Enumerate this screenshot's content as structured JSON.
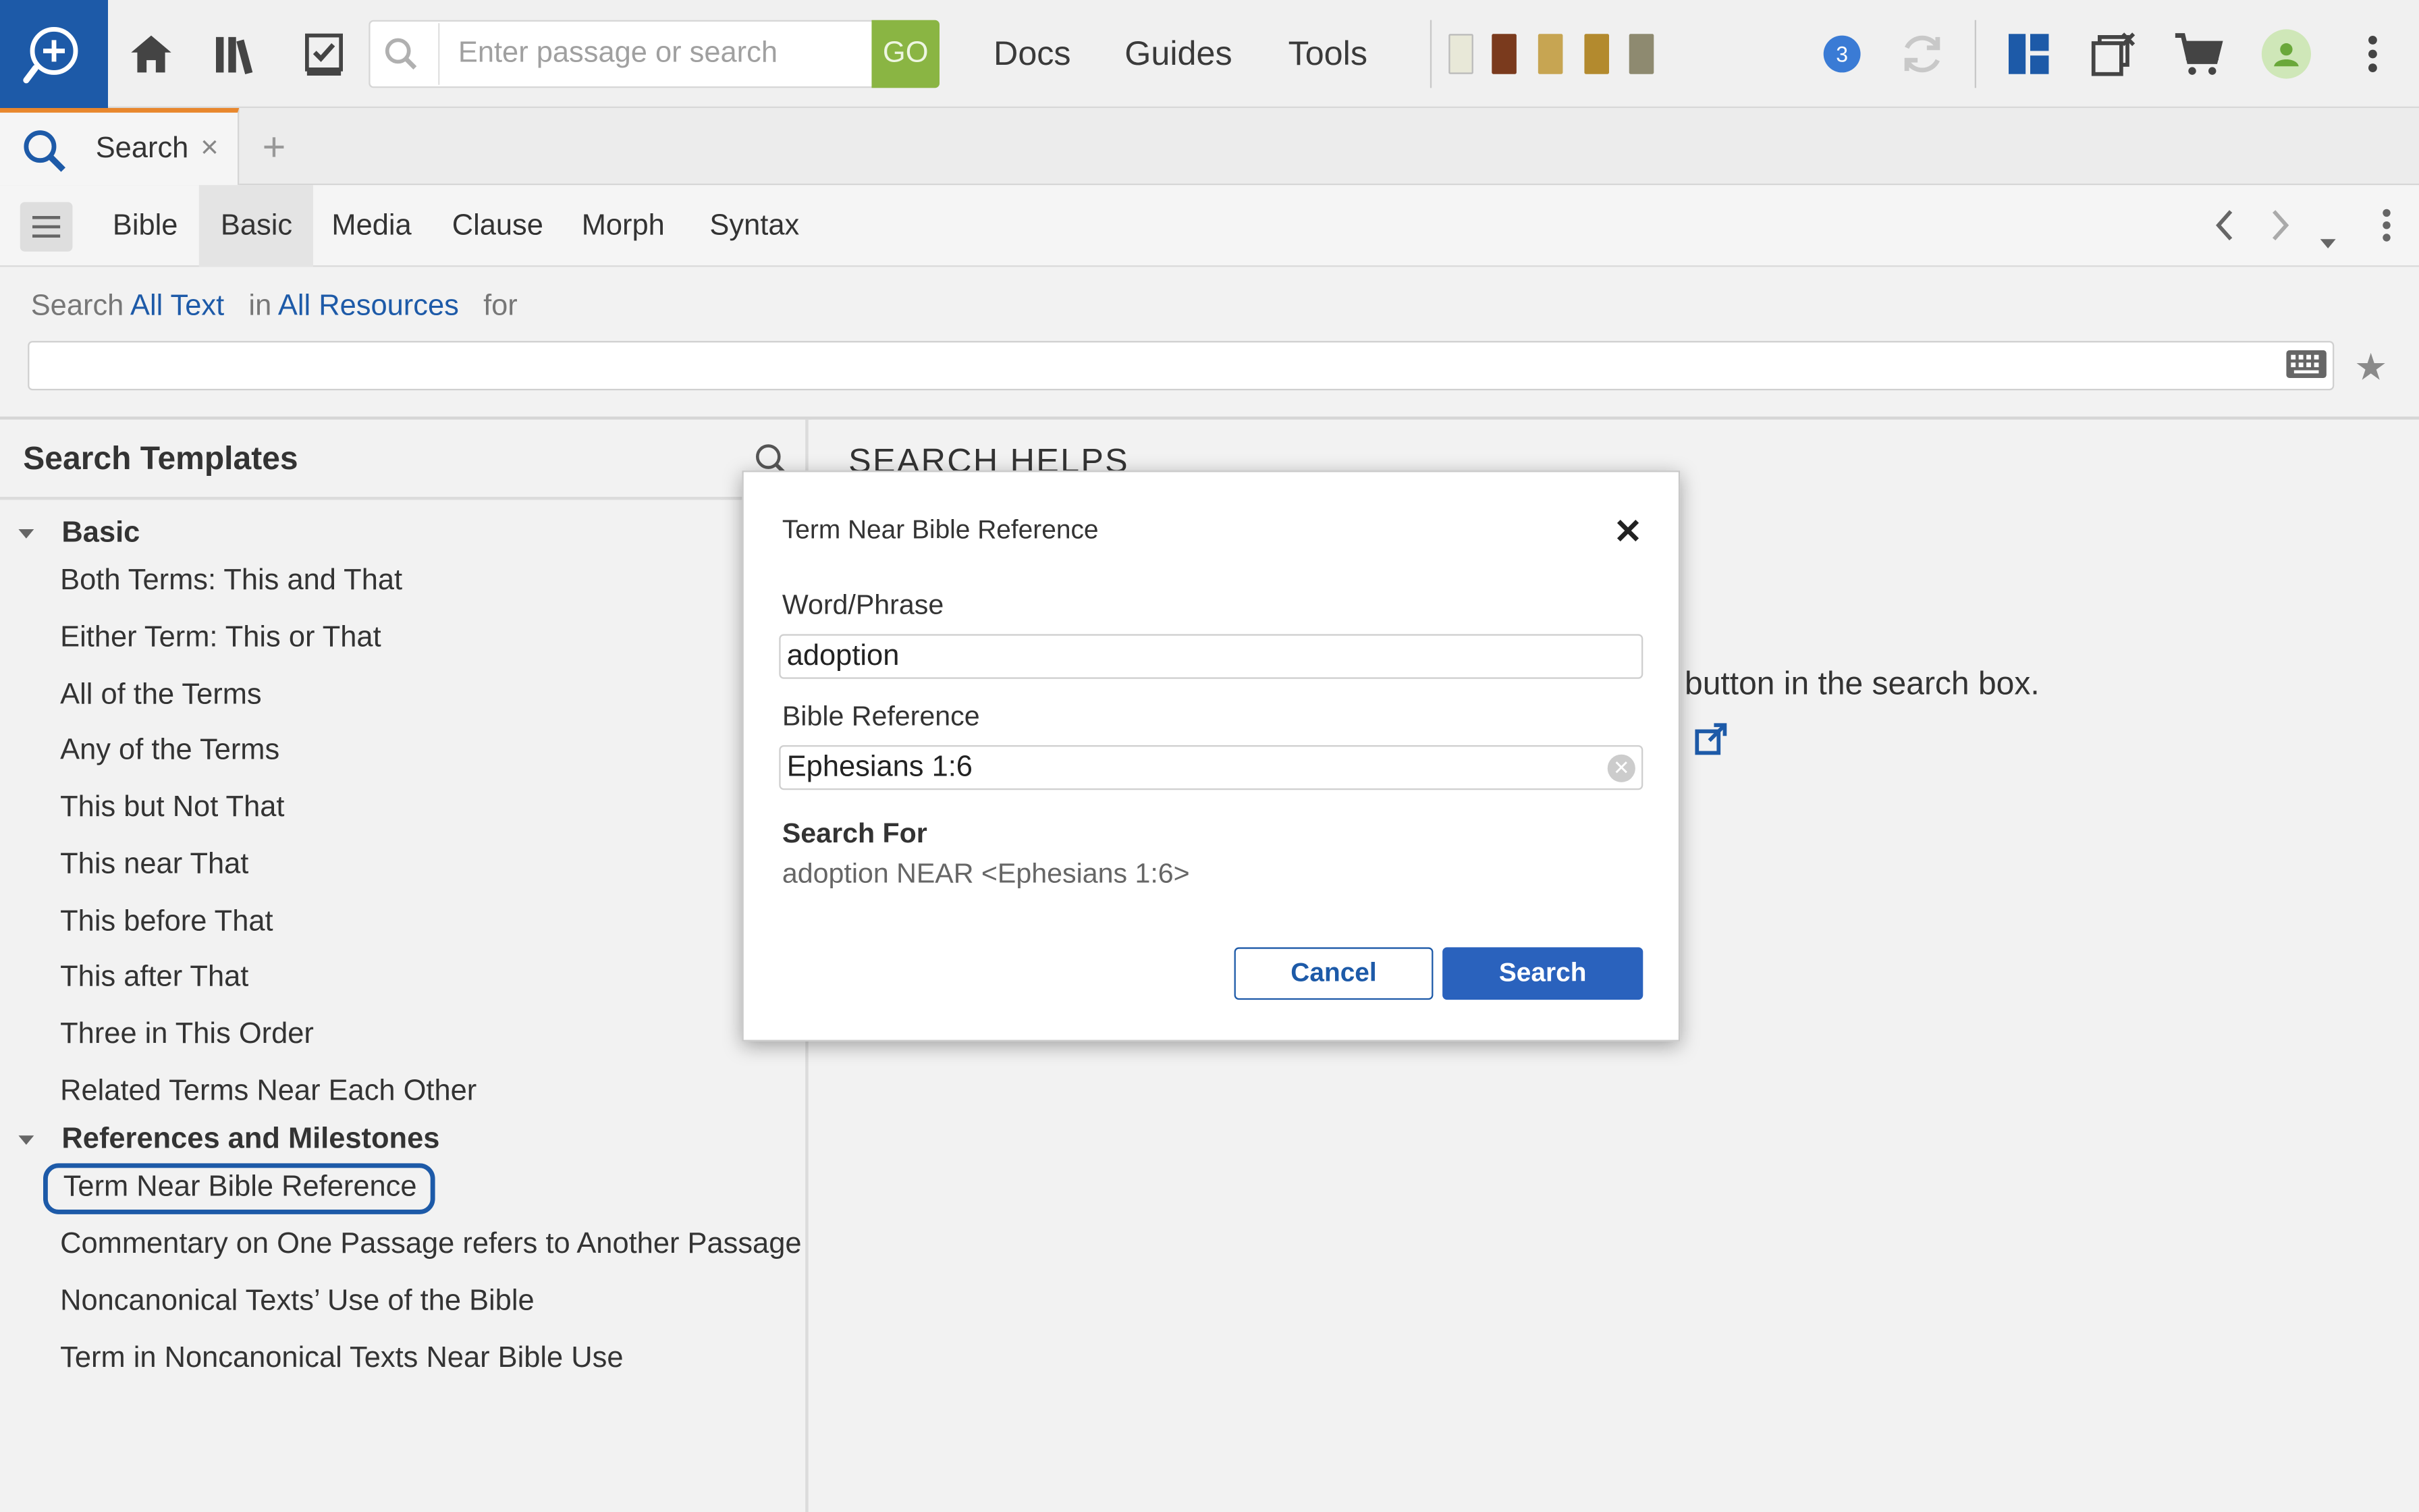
{
  "topbar": {
    "search_placeholder": "Enter passage or search",
    "go_label": "GO",
    "menus": [
      "Docs",
      "Guides",
      "Tools"
    ],
    "notification_count": "3"
  },
  "tab": {
    "label": "Search",
    "close": "×",
    "add": "+"
  },
  "toolbar": {
    "tabs": [
      "Bible",
      "Basic",
      "Media",
      "Clause",
      "Morph",
      "Syntax"
    ],
    "active_tab": "Basic"
  },
  "search_line": {
    "prefix": "Search",
    "scope": "All Text",
    "in": "in",
    "resources": "All Resources",
    "for": "for",
    "query_value": ""
  },
  "templates": {
    "title": "Search Templates",
    "groups": [
      {
        "name": "Basic",
        "items": [
          "Both Terms: This and That",
          "Either Term: This or That",
          "All of the Terms",
          "Any of the Terms",
          "This but Not That",
          "This near That",
          "This before That",
          "This after That",
          "Three in This Order",
          "Related Terms Near Each Other"
        ]
      },
      {
        "name": "References and Milestones",
        "items": [
          "Term Near Bible Reference",
          "Commentary on One Passage refers to Another Passage",
          "Noncanonical Texts’ Use of the Bible",
          "Term in Noncanonical Texts Near Bible Use"
        ]
      }
    ],
    "selected": "Term Near Bible Reference"
  },
  "helps": {
    "title": "SEARCH HELPS",
    "partial_text": "button in the search box."
  },
  "dialog": {
    "title": "Term Near Bible Reference",
    "word_label": "Word/Phrase",
    "word_value": "adoption",
    "ref_label": "Bible Reference",
    "ref_value": "Ephesians 1:6",
    "search_for_label": "Search For",
    "search_for_value": "adoption NEAR <Ephesians 1:6>",
    "cancel_label": "Cancel",
    "search_label": "Search"
  },
  "colors": {
    "brand_blue": "#1d5aa8",
    "go_green": "#8ab543",
    "tab_accent": "#e8872d",
    "primary_button": "#2a62bd"
  }
}
